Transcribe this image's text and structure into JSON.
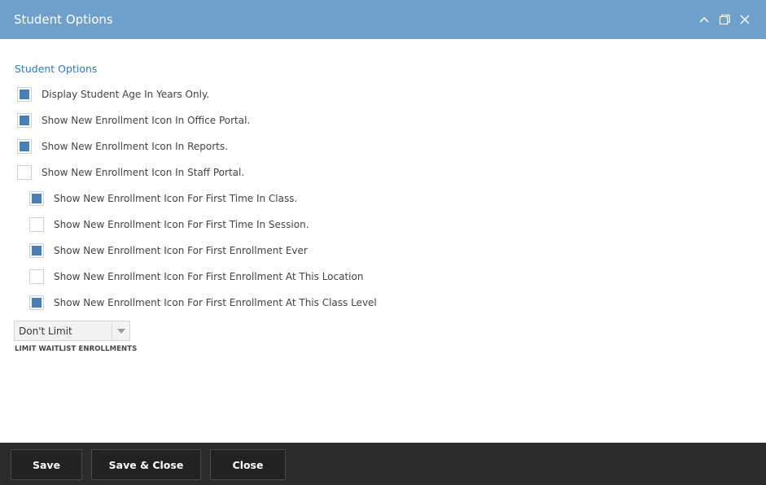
{
  "window": {
    "title": "Student Options",
    "controls": {
      "collapse_icon": "chevron-up-icon",
      "maximize_icon": "maximize-icon",
      "close_icon": "close-icon"
    }
  },
  "section_title": "Student Options",
  "options": [
    {
      "label": "Display Student Age In Years Only.",
      "checked": true
    },
    {
      "label": "Show New Enrollment Icon In Office Portal.",
      "checked": true
    },
    {
      "label": "Show New Enrollment Icon In Reports.",
      "checked": true
    },
    {
      "label": "Show New Enrollment Icon In Staff Portal.",
      "checked": false
    },
    {
      "label": "Show New Enrollment Icon For First Time In Class.",
      "checked": true
    },
    {
      "label": "Show New Enrollment Icon For First Time In Session.",
      "checked": false
    },
    {
      "label": "Show New Enrollment Icon For First Enrollment Ever",
      "checked": true
    },
    {
      "label": "Show New Enrollment Icon For First Enrollment At This Location",
      "checked": false
    },
    {
      "label": "Show New Enrollment Icon For First Enrollment At This Class Level",
      "checked": true
    }
  ],
  "waitlist": {
    "selected": "Don't Limit",
    "label": "LIMIT WAITLIST ENROLLMENTS"
  },
  "footer": {
    "save": "Save",
    "save_close": "Save & Close",
    "close": "Close"
  },
  "colors": {
    "titlebar": "#6f9fcb",
    "accent": "#2f7bc1",
    "checkbox_fill": "#4a7fb5",
    "footer": "#2b2b2b"
  }
}
